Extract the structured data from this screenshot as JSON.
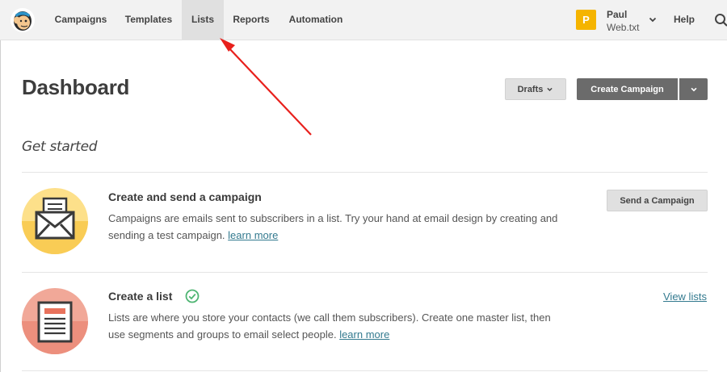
{
  "nav": {
    "items": [
      "Campaigns",
      "Templates",
      "Lists",
      "Reports",
      "Automation"
    ],
    "active": "Lists",
    "user": {
      "initial": "P",
      "name": "Paul",
      "org": "Web.txt"
    },
    "help": "Help"
  },
  "header": {
    "title": "Dashboard",
    "drafts_label": "Drafts",
    "create_label": "Create Campaign"
  },
  "get_started": {
    "heading": "Get started",
    "cards": [
      {
        "title": "Create and send a campaign",
        "desc_before": "Campaigns are emails sent to subscribers in a list. Try your hand at email design by creating and sending a test campaign.",
        "link": "learn more",
        "action": "Send a Campaign",
        "icon": "envelope-icon"
      },
      {
        "title": "Create a list",
        "desc_before": "Lists are where you store your contacts (we call them subscribers). Create one master list, then use segments and groups to email select people.",
        "link": "learn more",
        "action": "View lists",
        "icon": "list-document-icon",
        "completed": true
      }
    ]
  },
  "colors": {
    "nav_bg": "#f2f2f2",
    "primary_button": "#6b6b6b",
    "link": "#337a8f",
    "avatar": "#f5b400",
    "card1_icon_bg": "#fde08a",
    "card2_icon_bg": "#f1a898",
    "check": "#4fb573",
    "annotation_arrow": "#e8201c"
  }
}
